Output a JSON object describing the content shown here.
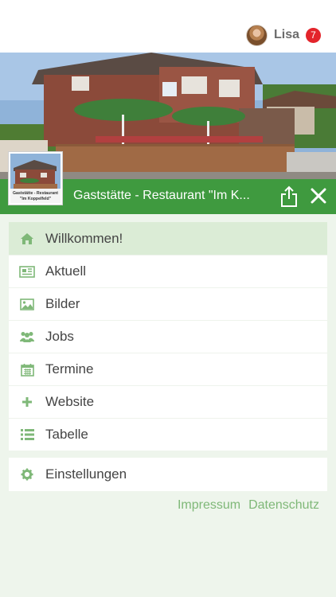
{
  "header": {
    "user_name": "Lisa",
    "notification_count": "7"
  },
  "venue": {
    "title": "Gaststätte - Restaurant \"Im K...",
    "thumb_caption_line1": "Gaststätte - Restaurant",
    "thumb_caption_line2": "\"Im Koppelfeld\""
  },
  "menu": {
    "items": [
      {
        "label": "Willkommen!",
        "icon": "home-icon",
        "active": true
      },
      {
        "label": "Aktuell",
        "icon": "newspaper-icon",
        "active": false
      },
      {
        "label": "Bilder",
        "icon": "image-icon",
        "active": false
      },
      {
        "label": "Jobs",
        "icon": "users-icon",
        "active": false
      },
      {
        "label": "Termine",
        "icon": "calendar-icon",
        "active": false
      },
      {
        "label": "Website",
        "icon": "plus-icon",
        "active": false
      },
      {
        "label": "Tabelle",
        "icon": "list-icon",
        "active": false
      }
    ],
    "settings_label": "Einstellungen"
  },
  "footer": {
    "impressum": "Impressum",
    "datenschutz": "Datenschutz"
  },
  "colors": {
    "accent_green": "#3f9a3f",
    "icon_green": "#7fb878",
    "active_bg": "#dbecd6",
    "badge_red": "#e3242b"
  }
}
